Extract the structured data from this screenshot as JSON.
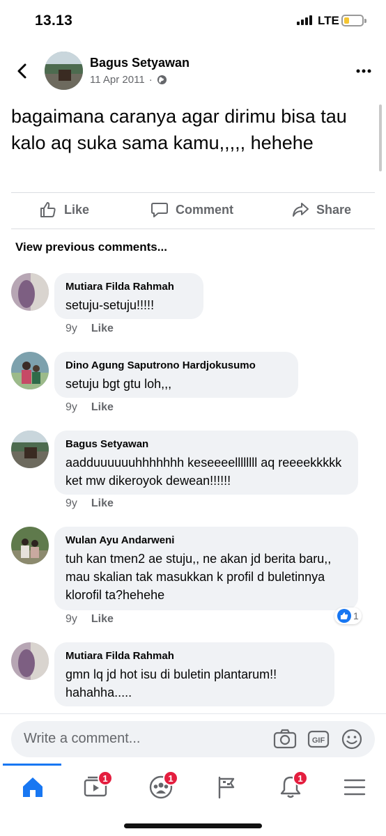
{
  "status_bar": {
    "time": "13.13",
    "network": "LTE"
  },
  "post": {
    "author": "Bagus Setyawan",
    "date": "11 Apr 2011",
    "separator": "·",
    "text": "bagaimana caranya agar dirimu bisa tau kalo aq suka sama kamu,,,,, hehehe"
  },
  "actions": {
    "like": "Like",
    "comment": "Comment",
    "share": "Share"
  },
  "view_previous": "View previous comments...",
  "comments": [
    {
      "name": "Mutiara Filda Rahmah",
      "text": "setuju-setuju!!!!!",
      "age": "9y",
      "like": "Like"
    },
    {
      "name": "Dino Agung Saputrono Hardjokusumo",
      "text": "setuju bgt gtu loh,,,",
      "age": "9y",
      "like": "Like"
    },
    {
      "name": "Bagus Setyawan",
      "text": "aadduuuuuuhhhhhhh keseeeellllllll aq reeeekkkkk ket mw dikeroyok dewean!!!!!!",
      "age": "9y",
      "like": "Like"
    },
    {
      "name": "Wulan Ayu Andarweni",
      "text": "tuh kan tmen2 ae stuju,, ne akan jd berita baru,, mau skalian tak masukkan k profil d buletinnya klorofil ta?hehehe",
      "age": "9y",
      "like": "Like",
      "reactions": "1"
    },
    {
      "name": "Mutiara Filda Rahmah",
      "text": "gmn lq jd hot isu di buletin plantarum!! hahahha.....",
      "age": "9y",
      "like": "Like"
    }
  ],
  "composer": {
    "placeholder": "Write a comment..."
  },
  "nav": {
    "watch_badge": "1",
    "groups_badge": "1",
    "notifications_badge": "1"
  },
  "colors": {
    "accent": "#1877f2",
    "badge": "#e41e3f",
    "bubble": "#f0f2f5"
  }
}
